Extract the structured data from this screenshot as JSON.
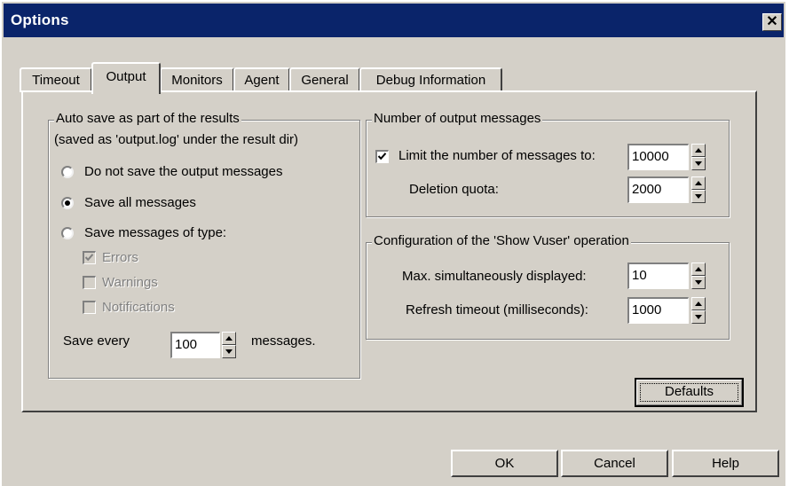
{
  "window": {
    "title": "Options",
    "close_glyph": "✕"
  },
  "tabs": [
    {
      "label": "Timeout",
      "active": false
    },
    {
      "label": "Output",
      "active": true
    },
    {
      "label": "Monitors",
      "active": false
    },
    {
      "label": "Agent",
      "active": false
    },
    {
      "label": "General",
      "active": false
    },
    {
      "label": "Debug Information",
      "active": false
    }
  ],
  "autosave": {
    "legend": "Auto save as part of the results",
    "note": "(saved as 'output.log' under the result dir)",
    "options": [
      {
        "label": "Do not save the output messages",
        "selected": false
      },
      {
        "label": "Save all messages",
        "selected": true
      },
      {
        "label": "Save messages of type:",
        "selected": false
      }
    ],
    "types": [
      {
        "label": "Errors",
        "checked": true,
        "enabled": false
      },
      {
        "label": "Warnings",
        "checked": false,
        "enabled": false
      },
      {
        "label": "Notifications",
        "checked": false,
        "enabled": false
      }
    ],
    "save_every_label": "Save every",
    "save_every_value": "100",
    "save_every_suffix": "messages."
  },
  "output_messages": {
    "legend": "Number of output messages",
    "limit_label": "Limit the number of messages to:",
    "limit_checked": true,
    "limit_value": "10000",
    "deletion_label": "Deletion quota:",
    "deletion_value": "2000"
  },
  "show_vuser": {
    "legend": "Configuration of the 'Show Vuser' operation",
    "max_label": "Max. simultaneously displayed:",
    "max_value": "10",
    "refresh_label": "Refresh timeout (milliseconds):",
    "refresh_value": "1000"
  },
  "buttons": {
    "defaults": "Defaults",
    "ok": "OK",
    "cancel": "Cancel",
    "help": "Help"
  }
}
